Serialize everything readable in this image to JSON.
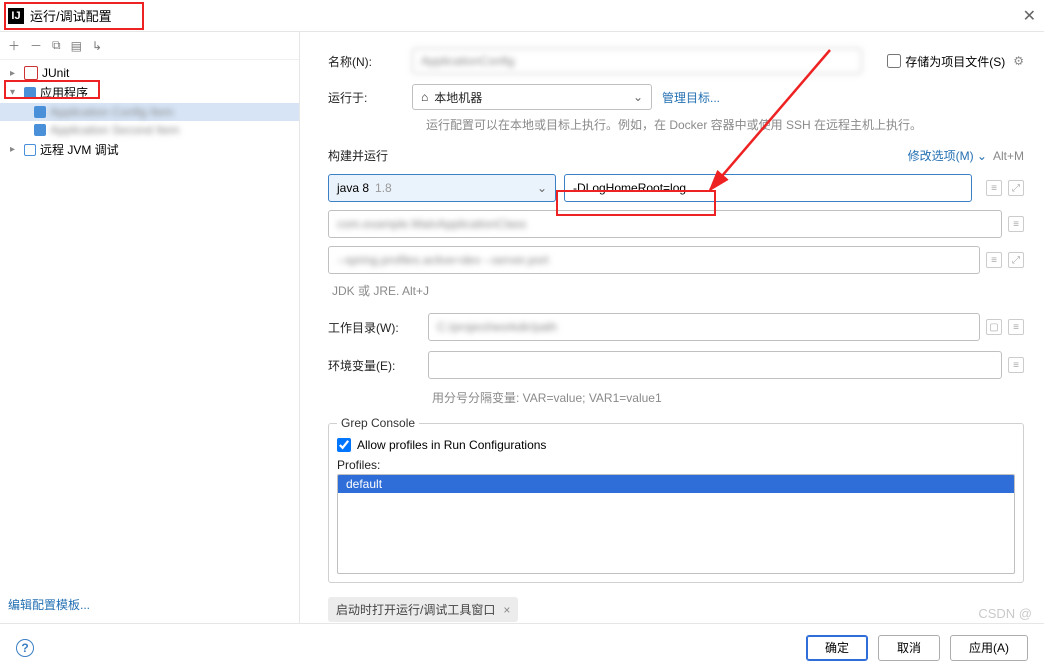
{
  "title": "运行/调试配置",
  "toolbar_icons": [
    "＋",
    "－",
    "⧉",
    "▤",
    "↳"
  ],
  "tree": {
    "junit": "JUnit",
    "app": "应用程序",
    "remote": "远程 JVM 调试"
  },
  "edit_template": "编辑配置模板...",
  "labels": {
    "name": "名称(N):",
    "run_on": "运行于:",
    "build_run": "构建并运行",
    "modify": "修改选项(M)",
    "modify_short": "Alt+M",
    "manage_target": "管理目标...",
    "run_hint": "运行配置可以在本地或目标上执行。例如，在 Docker 容器中或使用 SSH 在远程主机上执行。",
    "jdk_hint": "JDK 或 JRE. Alt+J",
    "work_dir": "工作目录(W):",
    "env": "环境变量(E):",
    "env_hint": "用分号分隔变量: VAR=value; VAR1=value1",
    "store": "存储为项目文件(S)"
  },
  "runon": {
    "value": "本地机器",
    "icon": "⌂"
  },
  "java": {
    "label": "java 8",
    "ver": "1.8"
  },
  "vm_options": "-DLogHomeRoot=log",
  "grep": {
    "legend": "Grep Console",
    "allow": "Allow profiles in Run Configurations",
    "profiles_label": "Profiles:",
    "profile_sel": "default"
  },
  "tag": "启动时打开运行/调试工具窗口",
  "buttons": {
    "ok": "确定",
    "cancel": "取消",
    "apply": "应用(A)"
  },
  "watermark": "CSDN @"
}
